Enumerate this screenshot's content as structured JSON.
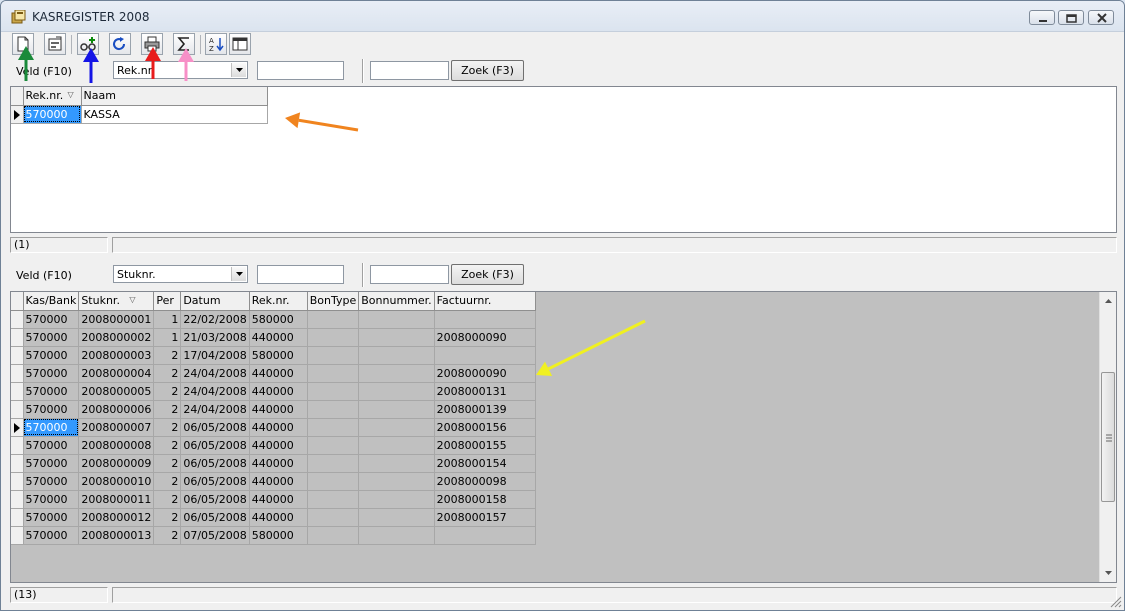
{
  "window": {
    "title": "KASREGISTER 2008"
  },
  "toolbar": {
    "buttons": [
      {
        "name": "new-document-icon"
      },
      {
        "name": "properties-icon"
      },
      {
        "name": "add-record-icon"
      },
      {
        "name": "refresh-icon"
      },
      {
        "name": "print-icon"
      },
      {
        "name": "sum-icon"
      },
      {
        "name": "sort-az-icon"
      },
      {
        "name": "layout-icon"
      }
    ]
  },
  "top_search": {
    "veld_label": "Veld (F10)",
    "field_value": "Rek.nr.",
    "filter_value": "",
    "search_value": "",
    "zoek_label": "Zoek (F3)"
  },
  "top_grid": {
    "columns": [
      "Rek.nr.",
      "Naam"
    ],
    "rows": [
      [
        "570000",
        "KASSA"
      ]
    ]
  },
  "top_status": {
    "count": "(1)"
  },
  "bottom_search": {
    "veld_label": "Veld (F10)",
    "field_value": "Stuknr.",
    "filter_value": "",
    "search_value": "",
    "zoek_label": "Zoek (F3)"
  },
  "bottom_grid": {
    "columns": [
      "Kas/Bank",
      "Stuknr.",
      "Per",
      "Datum",
      "Rek.nr.",
      "BonType",
      "Bonnummer.",
      "Factuurnr."
    ],
    "rows": [
      [
        "570000",
        "2008000001",
        "1",
        "22/02/2008",
        "580000",
        "",
        "",
        ""
      ],
      [
        "570000",
        "2008000002",
        "1",
        "21/03/2008",
        "440000",
        "",
        "",
        "2008000090"
      ],
      [
        "570000",
        "2008000003",
        "2",
        "17/04/2008",
        "580000",
        "",
        "",
        ""
      ],
      [
        "570000",
        "2008000004",
        "2",
        "24/04/2008",
        "440000",
        "",
        "",
        "2008000090"
      ],
      [
        "570000",
        "2008000005",
        "2",
        "24/04/2008",
        "440000",
        "",
        "",
        "2008000131"
      ],
      [
        "570000",
        "2008000006",
        "2",
        "24/04/2008",
        "440000",
        "",
        "",
        "2008000139"
      ],
      [
        "570000",
        "2008000007",
        "2",
        "06/05/2008",
        "440000",
        "",
        "",
        "2008000156"
      ],
      [
        "570000",
        "2008000008",
        "2",
        "06/05/2008",
        "440000",
        "",
        "",
        "2008000155"
      ],
      [
        "570000",
        "2008000009",
        "2",
        "06/05/2008",
        "440000",
        "",
        "",
        "2008000154"
      ],
      [
        "570000",
        "2008000010",
        "2",
        "06/05/2008",
        "440000",
        "",
        "",
        "2008000098"
      ],
      [
        "570000",
        "2008000011",
        "2",
        "06/05/2008",
        "440000",
        "",
        "",
        "2008000158"
      ],
      [
        "570000",
        "2008000012",
        "2",
        "06/05/2008",
        "440000",
        "",
        "",
        "2008000157"
      ],
      [
        "570000",
        "2008000013",
        "2",
        "07/05/2008",
        "580000",
        "",
        "",
        ""
      ]
    ]
  },
  "bottom_status": {
    "count": "(13)"
  },
  "annotation_colors": {
    "green": "#1a8a3a",
    "blue": "#1414e6",
    "red": "#e81c1c",
    "pink": "#f78fc7",
    "orange": "#f0841f",
    "yellow": "#f0f020"
  }
}
